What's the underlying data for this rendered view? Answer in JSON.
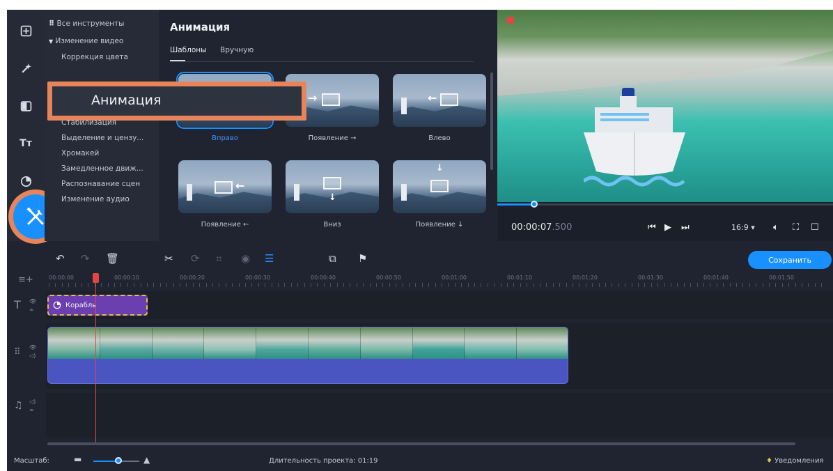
{
  "colors": {
    "accent": "#1890ff",
    "highlight": "#e8845a",
    "playhead": "#e04646",
    "title_clip": "#6b3fb0",
    "video_clip": "#4a55c2"
  },
  "rail": {
    "icons": [
      "import-icon",
      "magic-wand-icon",
      "transitions-icon",
      "titles-icon",
      "stickers-icon",
      "tools-icon"
    ],
    "titles_glyph": "Тт"
  },
  "tree": {
    "all_tools": "Все инструменты",
    "group": "Изменение видео",
    "items": [
      "Коррекция цвета",
      "Стабилизация",
      "Выделение и цензу...",
      "Хромакей",
      "Замедленное движ...",
      "Распознавание сцен",
      "Изменение аудио"
    ]
  },
  "panel": {
    "title": "Анимация",
    "tabs": [
      "Шаблоны",
      "Вручную"
    ],
    "active_tab": "Шаблоны",
    "presets": [
      {
        "label": "Вправо",
        "selected": true
      },
      {
        "label": "Появление →",
        "selected": false
      },
      {
        "label": "Влево",
        "selected": false
      },
      {
        "label": "Появление ←",
        "selected": false
      },
      {
        "label": "Вниз",
        "selected": false
      },
      {
        "label": "Появление ↓",
        "selected": false
      }
    ]
  },
  "callout": {
    "text": "Анимация"
  },
  "preview": {
    "time_main": "00:00:07",
    "time_ms": ".500",
    "progress": 0.11,
    "aspect": "16:9 ▾"
  },
  "toolbar": {
    "save_label": "Сохранить"
  },
  "ruler": {
    "labels": [
      "00:00:00",
      "00:00:10",
      "00:00:20",
      "00:00:30",
      "00:00:40",
      "00:00:50",
      "00:01:00",
      "00:01:10",
      "00:01:20",
      "00:01:30",
      "00:01:40",
      "00:01:50"
    ]
  },
  "timeline": {
    "title_clip": "Корабль",
    "frame_count": 10
  },
  "status": {
    "zoom_label": "Масштаб:",
    "zoom_level": 0.55,
    "duration": "Длительность проекта: 01:19",
    "notifications": "Уведомления"
  }
}
